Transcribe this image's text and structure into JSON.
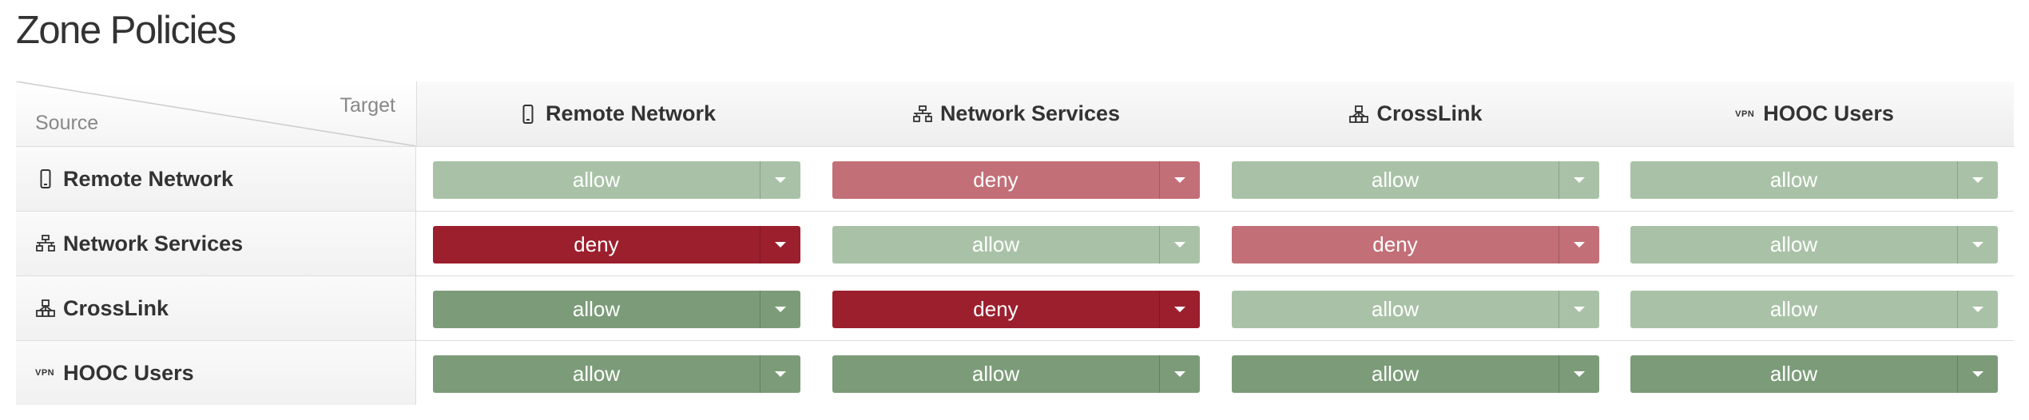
{
  "page": {
    "title": "Zone Policies"
  },
  "corner": {
    "target_label": "Target",
    "source_label": "Source"
  },
  "columns": [
    {
      "label": "Remote Network",
      "icon": "mobile-phone-icon"
    },
    {
      "label": "Network Services",
      "icon": "network-tree-icon"
    },
    {
      "label": "CrossLink",
      "icon": "hierarchy-icon"
    },
    {
      "label": "HOOC Users",
      "icon": "vpn-icon",
      "icon_text": "VPN"
    }
  ],
  "rows": [
    {
      "label": "Remote Network",
      "icon": "mobile-phone-icon"
    },
    {
      "label": "Network Services",
      "icon": "network-tree-icon"
    },
    {
      "label": "CrossLink",
      "icon": "hierarchy-icon"
    },
    {
      "label": "HOOC Users",
      "icon": "vpn-icon",
      "icon_text": "VPN"
    }
  ],
  "policies": [
    [
      "allow",
      "deny",
      "allow",
      "allow"
    ],
    [
      "deny",
      "allow",
      "deny",
      "allow"
    ],
    [
      "allow",
      "deny",
      "allow",
      "allow"
    ],
    [
      "allow",
      "allow",
      "allow",
      "allow"
    ]
  ],
  "colors": {
    "allow_light": "#a9c2a7",
    "allow_dark": "#7c9c79",
    "deny_light": "#c26f77",
    "deny_dark": "#9c1f2e"
  },
  "cell_shades": [
    [
      "light",
      "light",
      "light",
      "light"
    ],
    [
      "dark",
      "light",
      "light",
      "light"
    ],
    [
      "dark",
      "dark",
      "light",
      "light"
    ],
    [
      "dark",
      "dark",
      "dark",
      "dark"
    ]
  ]
}
